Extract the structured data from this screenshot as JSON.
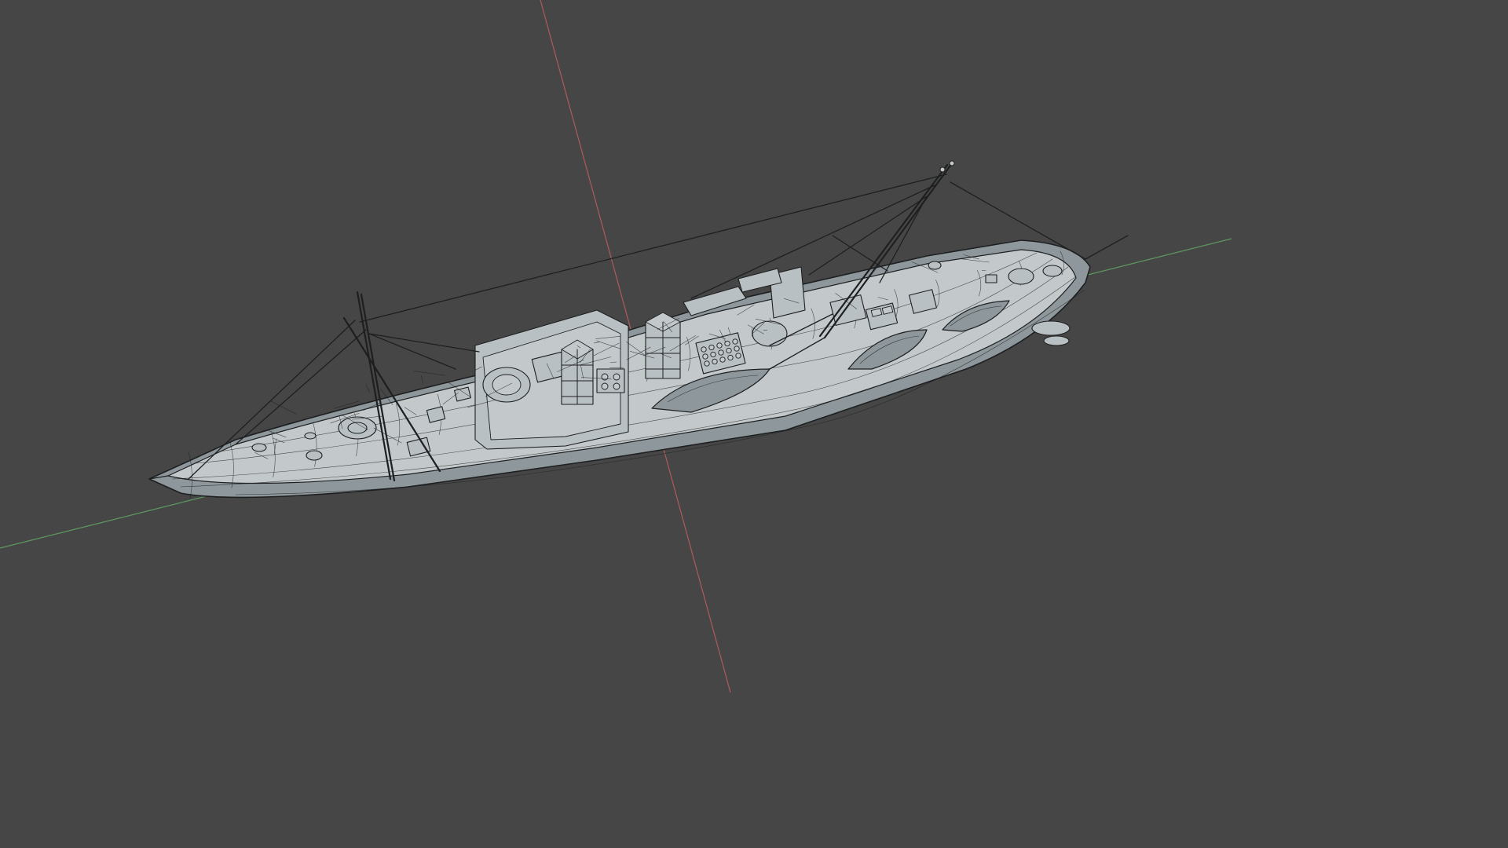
{
  "viewport": {
    "background_color": "#464646",
    "axis_x_color": "#b05a5a",
    "axis_y_color": "#5c9a62",
    "model": {
      "object": "ship-wireframe",
      "hull_fill": "#c3c9cb",
      "deck_fill": "#b9c0c3",
      "wire_color": "#1e1f20",
      "shadow_color": "#8e979b"
    }
  }
}
